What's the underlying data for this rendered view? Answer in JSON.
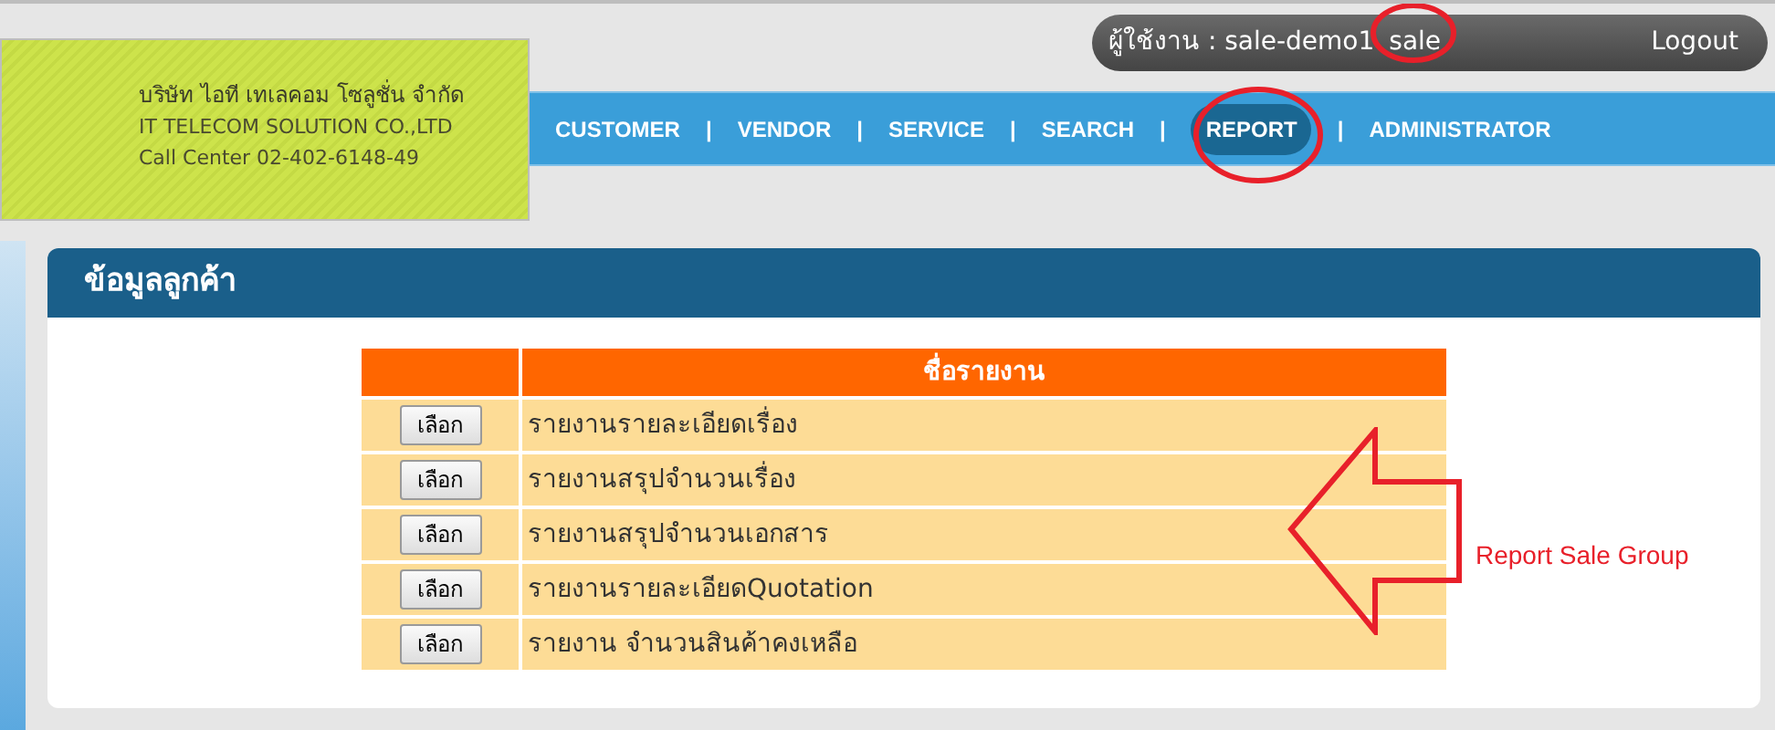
{
  "company": {
    "name_th": "บริษัท ไอที เทเลคอม โซลูชั่น จำกัด",
    "name_en": "IT TELECOM SOLUTION CO.,LTD",
    "call_center": "Call Center 02-402-6148-49"
  },
  "user_bar": {
    "user_label": "ผู้ใช้งาน : sale-demo1",
    "user_group": "sale",
    "logout": "Logout"
  },
  "nav": [
    {
      "kind": "link",
      "label": "CUSTOMER",
      "selected": false
    },
    {
      "kind": "separator",
      "label": "|"
    },
    {
      "kind": "link",
      "label": "VENDOR",
      "selected": false
    },
    {
      "kind": "separator",
      "label": "|"
    },
    {
      "kind": "link",
      "label": "SERVICE",
      "selected": false
    },
    {
      "kind": "separator",
      "label": "|"
    },
    {
      "kind": "link",
      "label": "SEARCH",
      "selected": false
    },
    {
      "kind": "separator",
      "label": "|"
    },
    {
      "kind": "link",
      "label": "REPORT",
      "selected": true
    },
    {
      "kind": "separator",
      "label": "|"
    },
    {
      "kind": "link",
      "label": "ADMINISTRATOR",
      "selected": false
    }
  ],
  "panel": {
    "title": "ข้อมูลลูกค้า",
    "table": {
      "columns": [
        "ชื่อรายงาน"
      ],
      "rows": [
        {
          "button": "เลือก",
          "name": "รายงานรายละเอียดเรื่อง"
        },
        {
          "button": "เลือก",
          "name": "รายงานสรุปจำนวนเรื่อง"
        },
        {
          "button": "เลือก",
          "name": "รายงานสรุปจำนวนเอกสาร"
        },
        {
          "button": "เลือก",
          "name": "รายงานรายละเอียดQuotation"
        },
        {
          "button": "เลือก",
          "name": "รายงาน จำนวนสินค้าคงเหลือ"
        }
      ]
    },
    "annotation": "Report Sale Group"
  }
}
